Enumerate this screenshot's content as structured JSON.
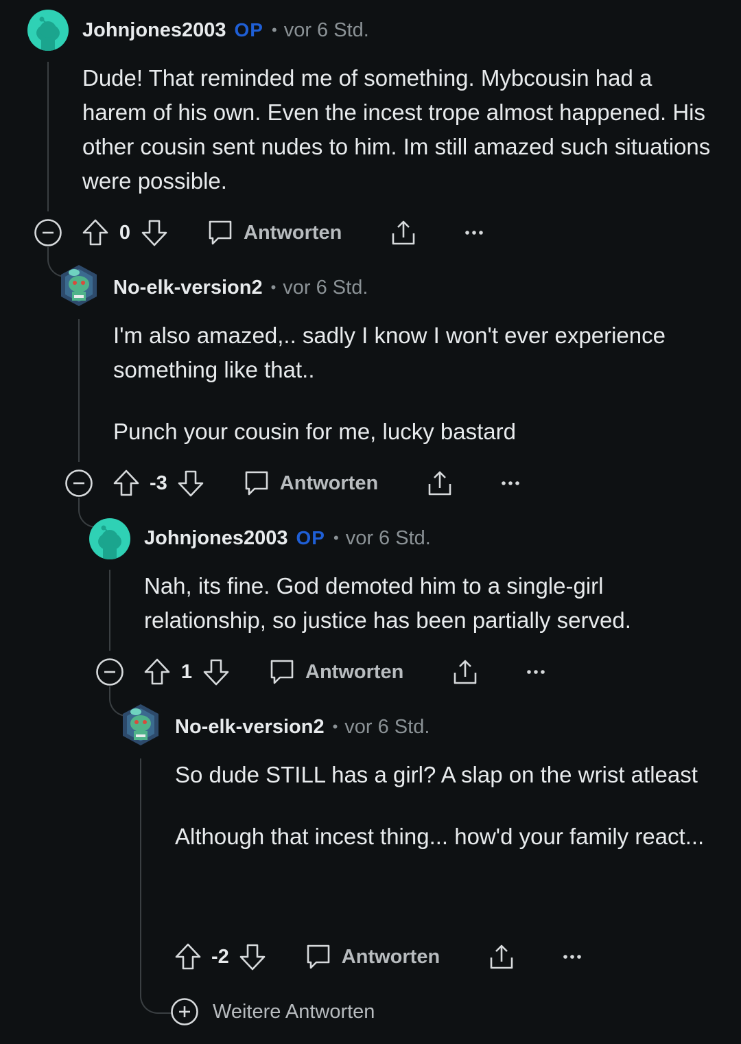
{
  "comments": [
    {
      "username": "Johnjones2003",
      "op_badge": "OP",
      "separator": "•",
      "time": "vor 6 Std.",
      "body": [
        "Dude! That reminded me of something. Mybcousin had a harem of his own. Even the incest trope almost happened. His other cousin sent nudes to him. Im still amazed such situations were possible."
      ],
      "score": "0",
      "reply_label": "Antworten",
      "avatar": "snoo-teal-avatar"
    },
    {
      "username": "No-elk-version2",
      "separator": "•",
      "time": "vor 6 Std.",
      "body": [
        "I'm also amazed,.. sadly I know I won't ever experience something like that..",
        "Punch your cousin for me, lucky bastard"
      ],
      "score": "-3",
      "reply_label": "Antworten",
      "avatar": "snoo-custom-avatar"
    },
    {
      "username": "Johnjones2003",
      "op_badge": "OP",
      "separator": "•",
      "time": "vor 6 Std.",
      "body": [
        "Nah, its fine. God demoted him to a single-girl relationship, so justice has been partially served."
      ],
      "score": "1",
      "reply_label": "Antworten",
      "avatar": "snoo-teal-avatar"
    },
    {
      "username": "No-elk-version2",
      "separator": "•",
      "time": "vor 6 Std.",
      "body": [
        "So dude STILL has a girl? A slap on the wrist atleast",
        "Although that incest thing... how'd your family react..."
      ],
      "score": "-2",
      "reply_label": "Antworten",
      "avatar": "snoo-custom-avatar"
    }
  ],
  "more_replies": "Weitere Antworten",
  "colors": {
    "background": "#0e1113",
    "op_badge": "#1f5fd6",
    "avatar_teal": "#2fd1b5",
    "thread_line": "#3a3f42"
  },
  "icons": [
    "collapse-icon",
    "upvote-icon",
    "downvote-icon",
    "comment-bubble-icon",
    "share-icon",
    "more-options-icon",
    "expand-plus-icon"
  ]
}
